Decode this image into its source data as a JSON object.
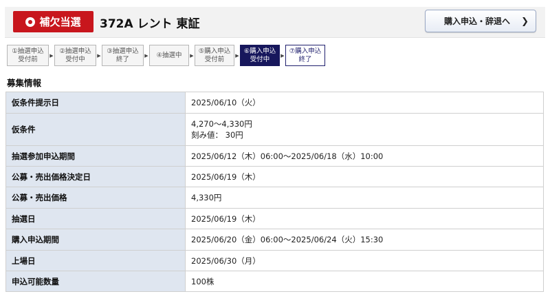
{
  "header": {
    "badge_label": "補欠当選",
    "title": "372A レント 東証",
    "buy_button_label": "購入申込・辞退へ",
    "buy_button_chevron": "❯"
  },
  "steps": [
    {
      "line1": "①抽選申込",
      "line2": "受付前",
      "state": "done"
    },
    {
      "line1": "②抽選申込",
      "line2": "受付中",
      "state": "done"
    },
    {
      "line1": "③抽選申込",
      "line2": "終了",
      "state": "done"
    },
    {
      "line1": "④抽選中",
      "line2": "",
      "state": "done"
    },
    {
      "line1": "⑤購入申込",
      "line2": "受付前",
      "state": "done"
    },
    {
      "line1": "⑥購入申込",
      "line2": "受付中",
      "state": "active"
    },
    {
      "line1": "⑦購入申込",
      "line2": "終了",
      "state": "next"
    }
  ],
  "section": {
    "title": "募集情報"
  },
  "rows": [
    {
      "label": "仮条件提示日",
      "value": "2025/06/10（火）"
    },
    {
      "label": "仮条件",
      "value": "4,270～4,330円",
      "value2": "刻み値： 30円"
    },
    {
      "label": "抽選参加申込期間",
      "value": "2025/06/12（木）06:00～2025/06/18（水）10:00"
    },
    {
      "label": "公募・売出価格決定日",
      "value": "2025/06/19（木）"
    },
    {
      "label": "公募・売出価格",
      "value": "4,330円"
    },
    {
      "label": "抽選日",
      "value": "2025/06/19（木）"
    },
    {
      "label": "購入申込期間",
      "value": "2025/06/20（金）06:00～2025/06/24（火）15:30"
    },
    {
      "label": "上場日",
      "value": "2025/06/30（月）"
    },
    {
      "label": "申込可能数量",
      "value": "100株"
    }
  ]
}
